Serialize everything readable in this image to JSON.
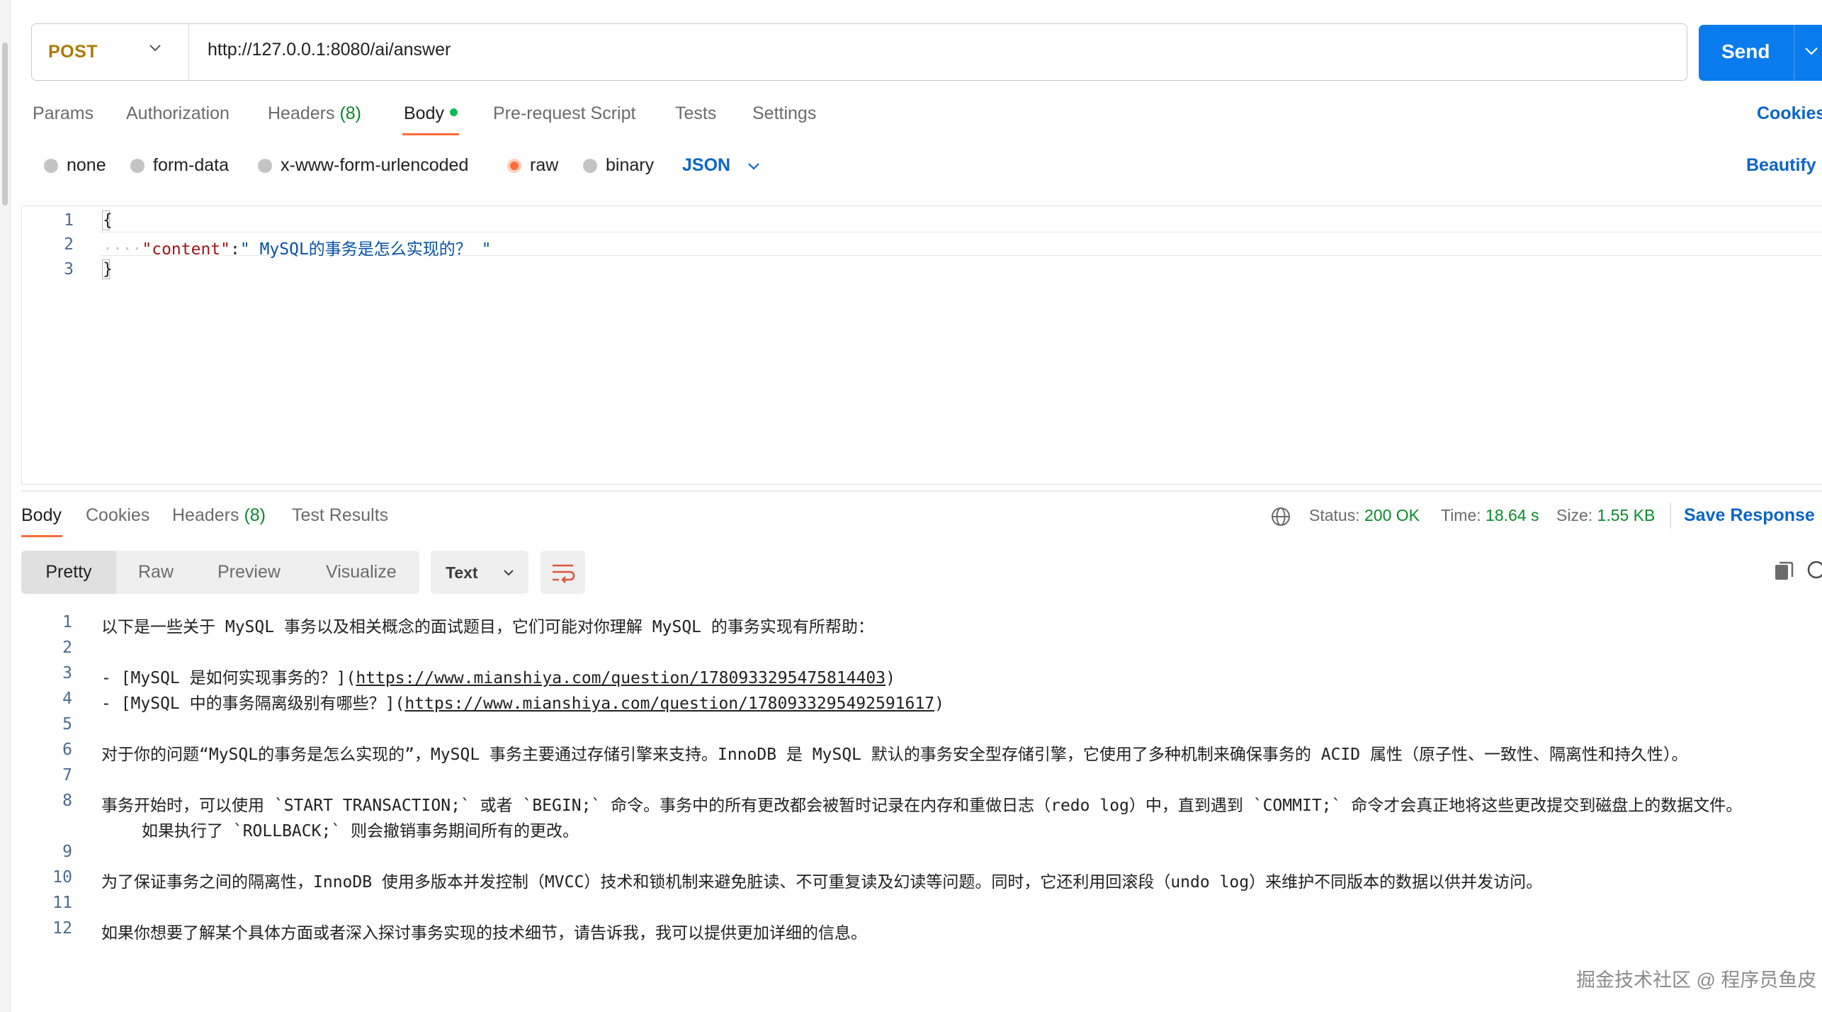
{
  "request": {
    "method": "POST",
    "url": "http://127.0.0.1:8080/ai/answer",
    "send_label": "Send",
    "tabs": [
      {
        "label": "Params"
      },
      {
        "label": "Authorization"
      },
      {
        "label": "Headers",
        "count": "(8)"
      },
      {
        "label": "Body"
      },
      {
        "label": "Pre-request Script"
      },
      {
        "label": "Tests"
      },
      {
        "label": "Settings"
      }
    ],
    "active_tab": "Body",
    "cookies_label": "Cookies",
    "body_types": [
      "none",
      "form-data",
      "x-www-form-urlencoded",
      "raw",
      "binary"
    ],
    "selected_body_type": "raw",
    "raw_format": "JSON",
    "beautify_label": "Beautify",
    "editor": {
      "line_numbers": [
        "1",
        "2",
        "3"
      ],
      "open_brace": "{",
      "key": "\"content\"",
      "colon": ":",
      "value": "\" MySQL的事务是怎么实现的？ \"",
      "close_brace": "}"
    }
  },
  "response": {
    "tabs": [
      {
        "label": "Body"
      },
      {
        "label": "Cookies"
      },
      {
        "label": "Headers",
        "count": "(8)"
      },
      {
        "label": "Test Results"
      }
    ],
    "active_tab": "Body",
    "status_label": "Status:",
    "status_value": "200 OK",
    "time_label": "Time:",
    "time_value": "18.64 s",
    "size_label": "Size:",
    "size_value": "1.55 KB",
    "save_label": "Save Response",
    "view_modes": [
      "Pretty",
      "Raw",
      "Preview",
      "Visualize"
    ],
    "active_view": "Pretty",
    "format": "Text",
    "lines": [
      {
        "n": "1",
        "text": "以下是一些关于 MySQL 事务以及相关概念的面试题目，它们可能对你理解 MySQL 的事务实现有所帮助："
      },
      {
        "n": "2",
        "text": ""
      },
      {
        "n": "3",
        "pre": "- [MySQL 是如何实现事务的？](",
        "link": "https://www.mianshiya.com/question/1780933295475814403",
        "post": ")"
      },
      {
        "n": "4",
        "pre": "- [MySQL 中的事务隔离级别有哪些？](",
        "link": "https://www.mianshiya.com/question/1780933295492591617",
        "post": ")"
      },
      {
        "n": "5",
        "text": ""
      },
      {
        "n": "6",
        "text": "对于你的问题“MySQL的事务是怎么实现的”，MySQL 事务主要通过存储引擎来支持。InnoDB 是 MySQL 默认的事务安全型存储引擎，它使用了多种机制来确保事务的 ACID 属性（原子性、一致性、隔离性和持久性）。"
      },
      {
        "n": "7",
        "text": ""
      },
      {
        "n": "8",
        "text": "事务开始时，可以使用 `START TRANSACTION;` 或者 `BEGIN;` 命令。事务中的所有更改都会被暂时记录在内存和重做日志（redo log）中，直到遇到 `COMMIT;` 命令才会真正地将这些更改提交到磁盘上的数据文件。",
        "cont": "如果执行了 `ROLLBACK;` 则会撤销事务期间所有的更改。"
      },
      {
        "n": "9",
        "text": ""
      },
      {
        "n": "10",
        "text": "为了保证事务之间的隔离性，InnoDB 使用多版本并发控制（MVCC）技术和锁机制来避免脏读、不可重复读及幻读等问题。同时，它还利用回滚段（undo log）来维护不同版本的数据以供并发访问。"
      },
      {
        "n": "11",
        "text": ""
      },
      {
        "n": "12",
        "text": "如果你想要了解某个具体方面或者深入探讨事务实现的技术细节，请告诉我，我可以提供更加详细的信息。"
      }
    ]
  },
  "watermark": "掘金技术社区 @ 程序员鱼皮",
  "colors": {
    "accent": "#ff6c37",
    "send": "#097bed",
    "link": "#0b65c8",
    "method_post": "#ad7a03",
    "status_ok": "#0a8a2a"
  }
}
